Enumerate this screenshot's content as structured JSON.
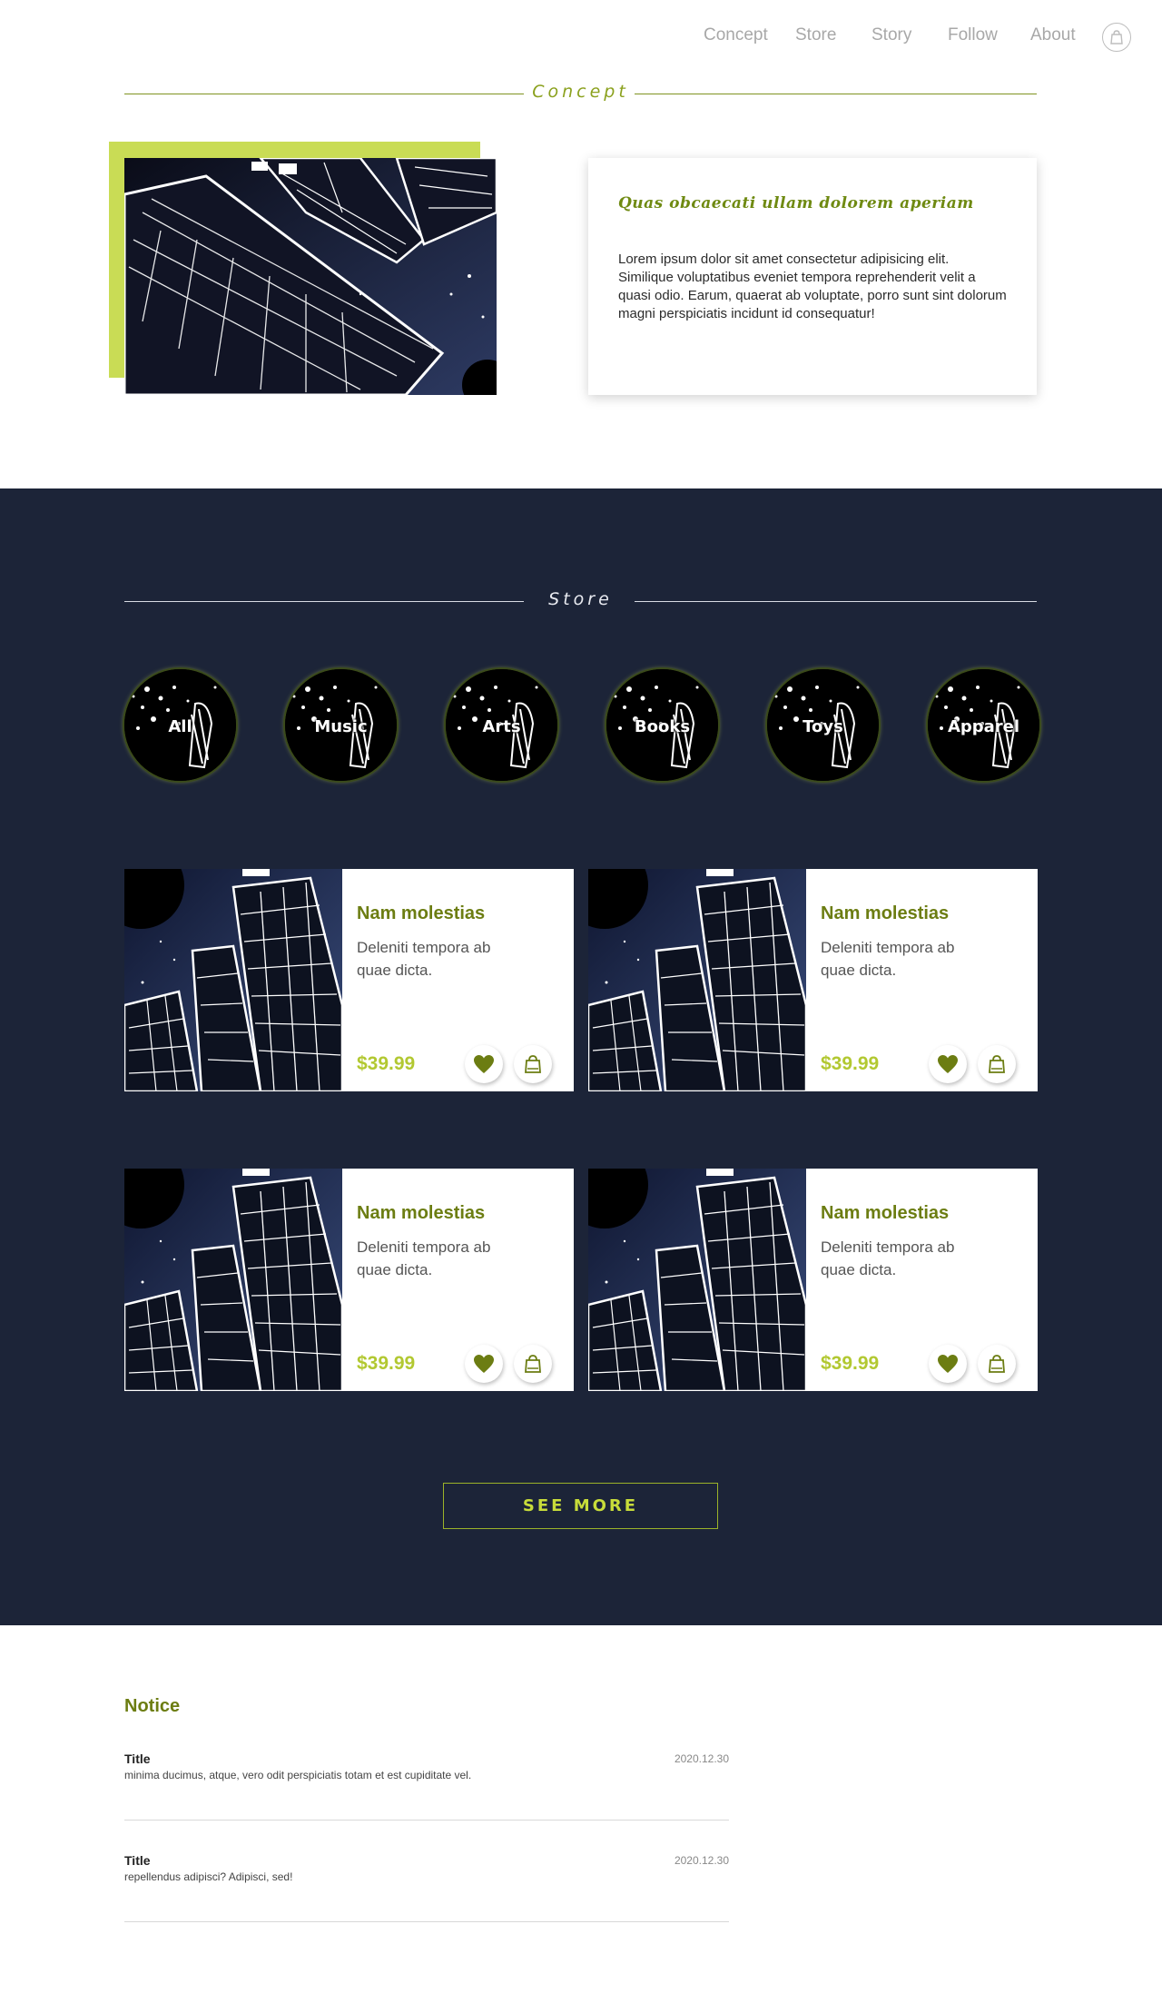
{
  "nav": {
    "links": [
      "Concept",
      "Store",
      "Story",
      "Follow",
      "About"
    ],
    "bag_icon": "shopping-bag-icon"
  },
  "concept": {
    "heading": "Concept",
    "card_title": "Quas obcaecati ullam dolorem aperiam",
    "card_text": "Lorem ipsum dolor sit amet consectetur adipisicing elit. Similique voluptatibus eveniet tempora reprehenderit velit a quasi odio. Earum, quaerat ab voluptate, porro sunt sint dolorum magni perspiciatis incidunt id consequatur!"
  },
  "store": {
    "heading": "Store",
    "categories": [
      "All",
      "Music",
      "Arts",
      "Books",
      "Toys",
      "Apparel"
    ],
    "products": [
      {
        "name": "Nam molestias",
        "desc": "Deleniti tempora ab quae dicta.",
        "price": "$39.99"
      },
      {
        "name": "Nam molestias",
        "desc": "Deleniti tempora ab quae dicta.",
        "price": "$39.99"
      },
      {
        "name": "Nam molestias",
        "desc": "Deleniti tempora ab quae dicta.",
        "price": "$39.99"
      },
      {
        "name": "Nam molestias",
        "desc": "Deleniti tempora ab quae dicta.",
        "price": "$39.99"
      }
    ],
    "see_more": "SEE MORE"
  },
  "notice": {
    "heading": "Notice",
    "items": [
      {
        "title": "Title",
        "body": "minima ducimus, atque, vero odit perspiciatis totam et est cupiditate vel.",
        "date": "2020.12.30"
      },
      {
        "title": "Title",
        "body": "repellendus adipisci? Adipisci, sed!",
        "date": "2020.12.30"
      }
    ]
  },
  "colors": {
    "accent": "#c9dc55",
    "olive": "#6c7d12",
    "navy": "#1c2438",
    "price": "#b2c831"
  }
}
